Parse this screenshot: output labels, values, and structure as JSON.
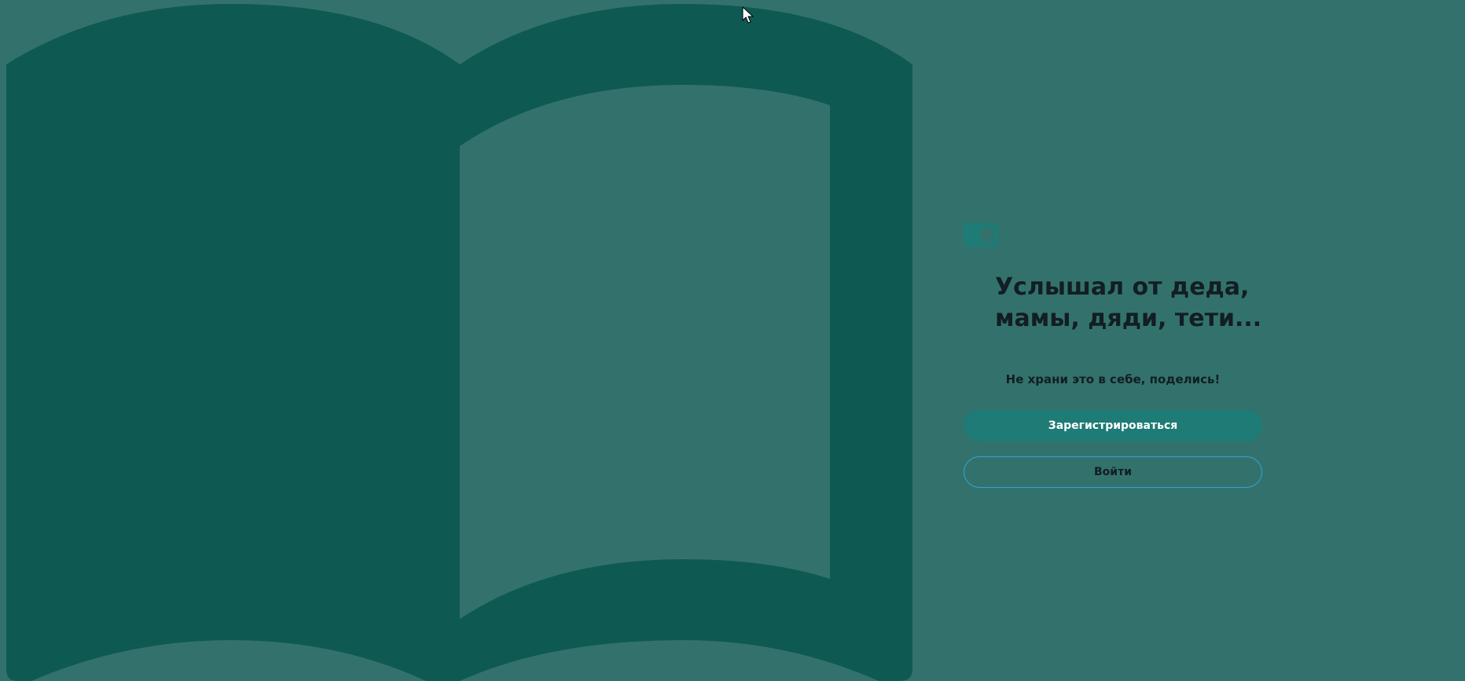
{
  "app": {
    "headline": "Услышал от деда,\nмамы, дяди, тети...",
    "subtitle": "Не храни это в себе, поделись!"
  },
  "actions": {
    "register_label": "Зарегистрироваться",
    "login_label": "Войти"
  },
  "icons": {
    "illustration": "open-book-icon",
    "logo": "book-logo-icon",
    "cursor": "mouse-cursor-icon"
  },
  "colors": {
    "background": "#33726c",
    "book": "#0f5953",
    "accent_button": "#1e7b75",
    "outline_button_border": "#2fa4d6",
    "text": "#121d24"
  }
}
